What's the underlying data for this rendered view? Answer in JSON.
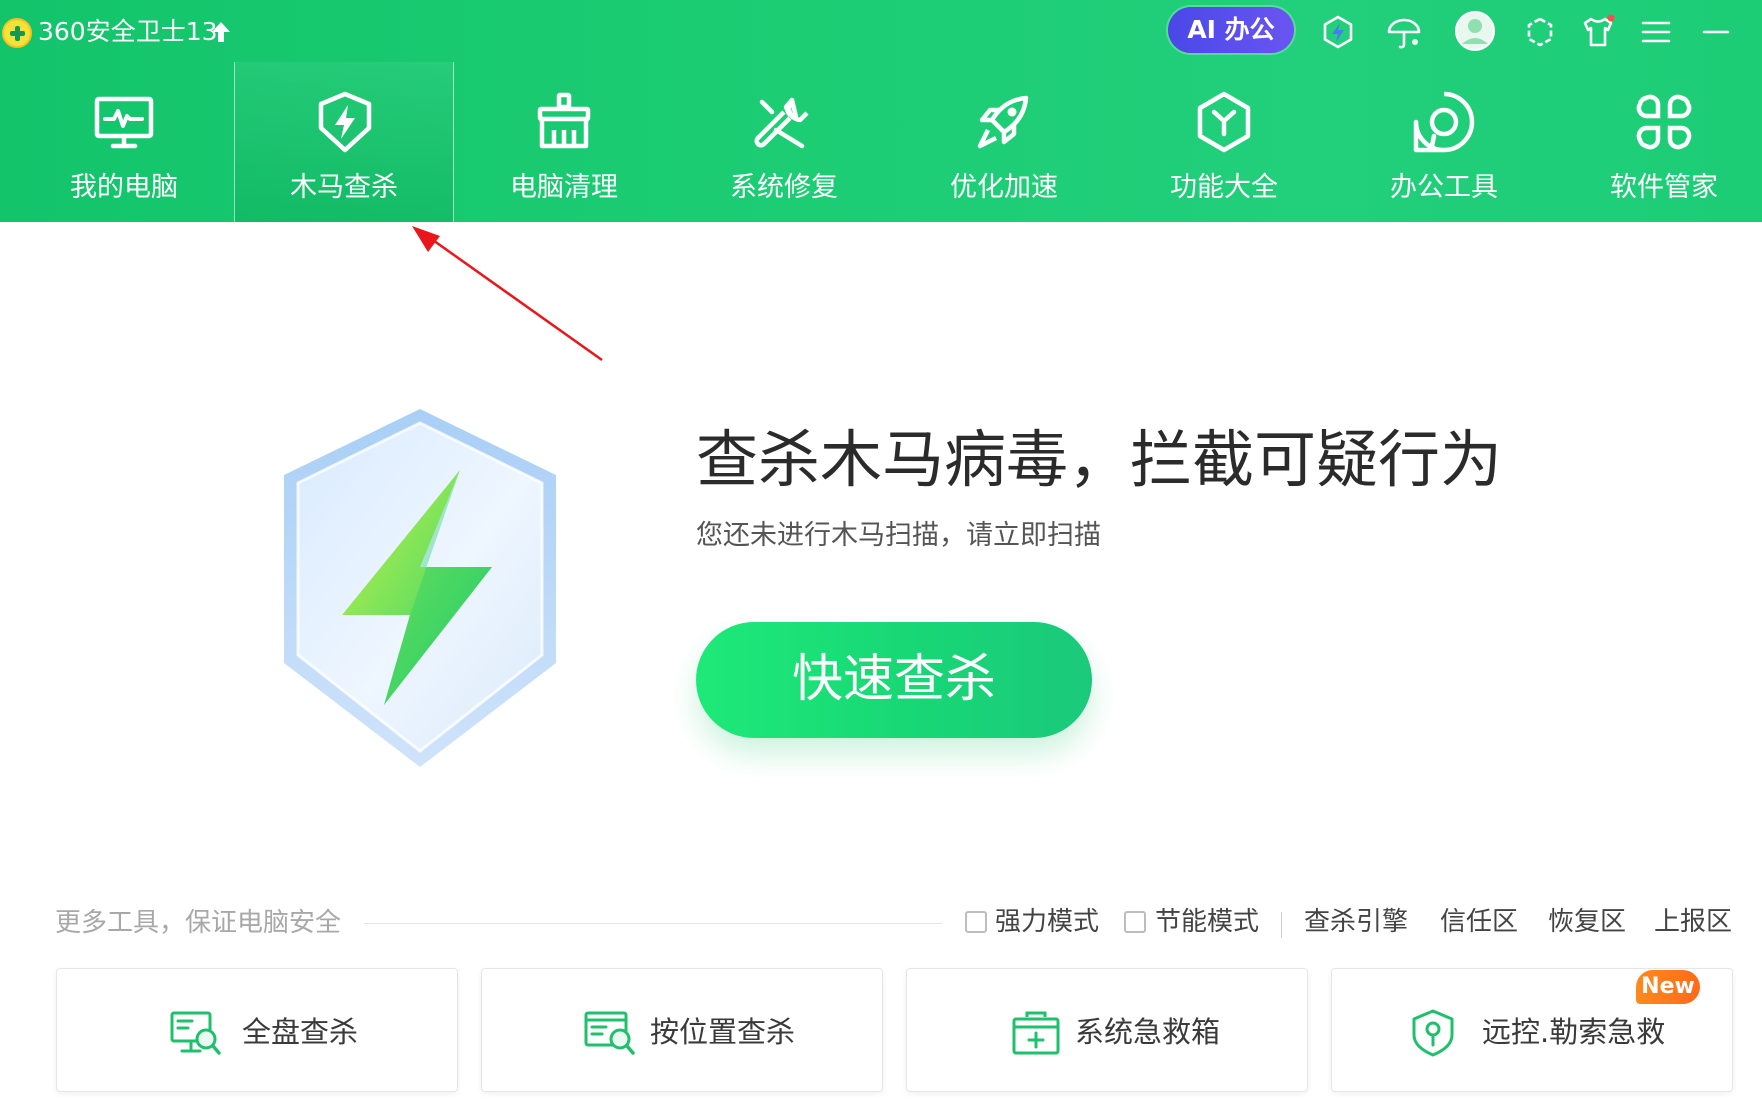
{
  "window": {
    "title": "360安全卫士13",
    "ai_button": "AI 办公"
  },
  "nav": {
    "items": [
      {
        "label": "我的电脑",
        "icon": "monitor-icon"
      },
      {
        "label": "木马查杀",
        "icon": "lightning-shield-icon",
        "active": true
      },
      {
        "label": "电脑清理",
        "icon": "broom-icon"
      },
      {
        "label": "系统修复",
        "icon": "wrench-icon"
      },
      {
        "label": "优化加速",
        "icon": "rocket-icon"
      },
      {
        "label": "功能大全",
        "icon": "cube-icon"
      },
      {
        "label": "办公工具",
        "icon": "office-icon"
      },
      {
        "label": "软件管家",
        "icon": "app-grid-icon"
      }
    ]
  },
  "hero": {
    "headline": "查杀木马病毒，拦截可疑行为",
    "subline": "您还未进行木马扫描，请立即扫描",
    "quick_scan_button": "快速查杀"
  },
  "tools": {
    "title": "更多工具，保证电脑安全",
    "options": {
      "strong_mode": "强力模式",
      "power_saving_mode": "节能模式",
      "engine": "查杀引擎",
      "trust_zone": "信任区",
      "recovery_zone": "恢复区",
      "report_zone": "上报区"
    },
    "cards": [
      {
        "label": "全盘查杀",
        "icon": "full-scan-icon"
      },
      {
        "label": "按位置查杀",
        "icon": "location-scan-icon"
      },
      {
        "label": "系统急救箱",
        "icon": "first-aid-kit-icon"
      },
      {
        "label": "远控.勒索急救",
        "icon": "lock-shield-icon",
        "badge": "New"
      }
    ]
  },
  "colors": {
    "brand_green": "#1ccd74",
    "button_green": "#1ee978",
    "ai_purple": "#5a50ee",
    "badge_orange": "#ff7a1c",
    "annotation_red": "#e8171c"
  }
}
